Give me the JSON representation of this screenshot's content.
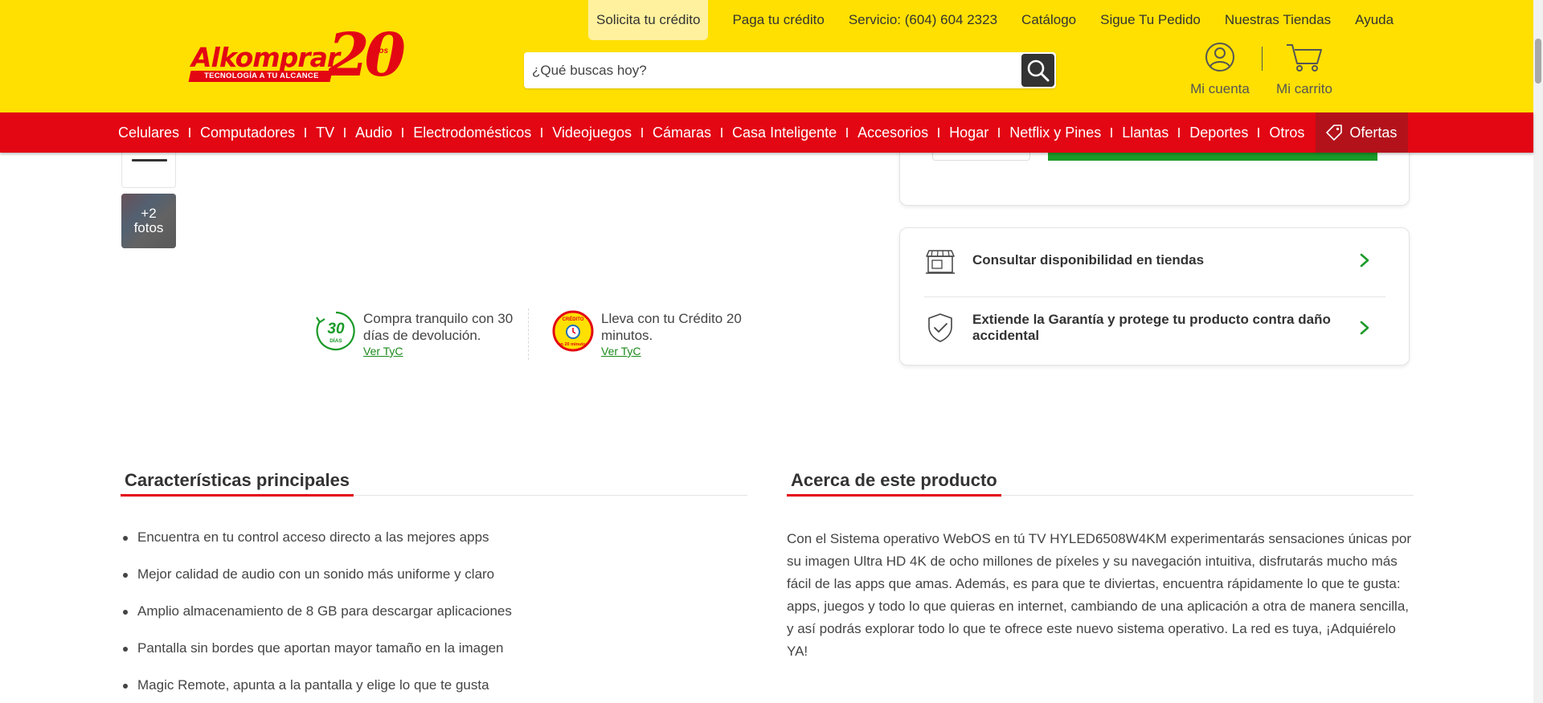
{
  "brand": {
    "logo_word": "Alkomprar",
    "logo_number": "20",
    "logo_years": "Años",
    "logo_tagline": "TECNOLOGÍA A TU ALCANCE",
    "primary_color": "#e30613",
    "header_color": "#ffe000"
  },
  "top_links": [
    "Solicita tu crédito",
    "Paga tu crédito",
    "Servicio: (604) 604 2323",
    "Catálogo",
    "Sigue Tu Pedido",
    "Nuestras Tiendas",
    "Ayuda"
  ],
  "search": {
    "placeholder": "¿Qué buscas hoy?",
    "icon": "search-icon"
  },
  "account": {
    "label": "Mi cuenta",
    "icon": "user-icon"
  },
  "cart": {
    "label": "Mi carrito",
    "icon": "cart-icon"
  },
  "nav": {
    "items": [
      "Celulares",
      "Computadores",
      "TV",
      "Audio",
      "Electrodomésticos",
      "Videojuegos",
      "Cámaras",
      "Casa Inteligente",
      "Accesorios",
      "Hogar",
      "Netflix y Pines",
      "Llantas",
      "Deportes",
      "Otros"
    ],
    "offers_label": "Ofertas",
    "offers_icon": "tag-icon"
  },
  "gallery": {
    "more_count": "+2",
    "more_label": "fotos"
  },
  "benefits": {
    "returns": {
      "badge_number": "30",
      "badge_label": "DÍAS",
      "text": "Compra tranquilo con 30 días de devolución.",
      "link": "Ver TyC"
    },
    "credit": {
      "badge_top": "CRÉDITO",
      "badge_bottom": "en 20 minutos",
      "text": "Lleva con tu Crédito 20 minutos.",
      "link": "Ver TyC"
    }
  },
  "store_card": {
    "availability": {
      "label": "Consultar disponibilidad en tiendas",
      "icon": "store-icon"
    },
    "warranty": {
      "label": "Extiende la Garantía y protege tu producto contra daño accidental",
      "icon": "shield-check-icon"
    }
  },
  "features": {
    "title": "Características principales",
    "items": [
      "Encuentra en tu control acceso directo a las mejores apps",
      "Mejor calidad de audio con un sonido más uniforme y claro",
      "Amplio almacenamiento de 8 GB para descargar aplicaciones",
      "Pantalla sin bordes que aportan mayor tamaño en la imagen",
      "Magic Remote, apunta a la pantalla y elige lo que te gusta"
    ]
  },
  "about": {
    "title": "Acerca de este producto",
    "text": "Con el Sistema operativo WebOS en tú TV HYLED6508W4KM experimentarás sensaciones únicas por su imagen Ultra HD 4K de ocho millones de píxeles y su navegación intuitiva, disfrutarás mucho más fácil de las apps que amas. Además, es para que te diviertas, encuentra rápidamente lo que te gusta: apps, juegos y todo lo que quieras en internet, cambiando de una aplicación a otra de manera sencilla, y así podrás explorar todo lo que te ofrece este nuevo sistema operativo. La red es tuya, ¡Adquiérelo YA!"
  }
}
